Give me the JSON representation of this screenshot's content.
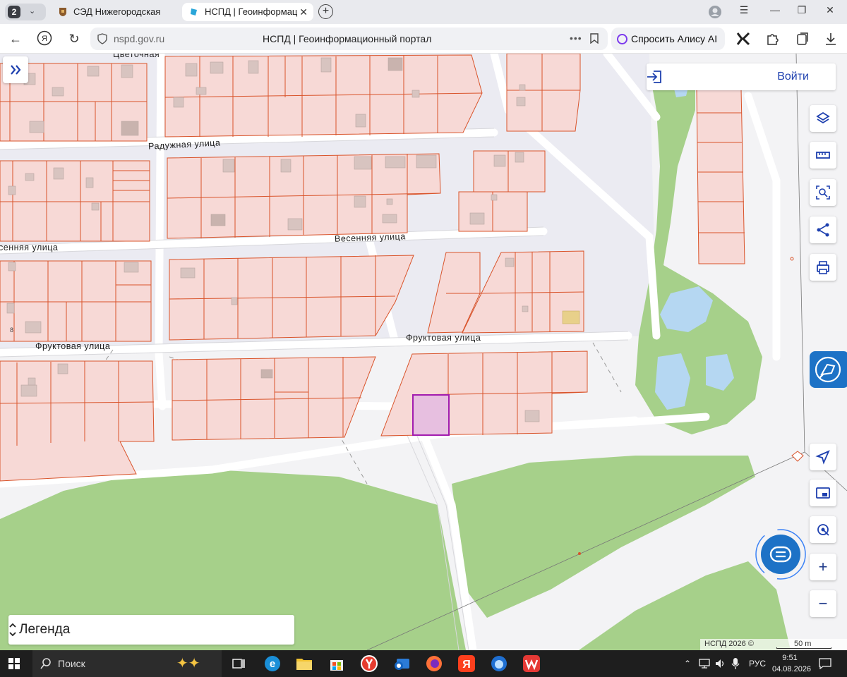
{
  "browser": {
    "tab_count": "2",
    "tabs": [
      {
        "title": "СЭД Нижегородская обл",
        "active": false
      },
      {
        "title": "НСПД | Геоинформаци",
        "active": true
      }
    ],
    "url": "nspd.gov.ru",
    "page_title": "НСПД | Геоинформационный портал",
    "alice_label": "Спросить Алису AI"
  },
  "map": {
    "login_label": "Войти",
    "legend_label": "Легенда",
    "copyright": "НСПД 2026 ©",
    "scale_label": "50 m",
    "streets": [
      {
        "label": "Цветочная"
      },
      {
        "label": "Радужная улица"
      },
      {
        "label": "Весенняя улица"
      },
      {
        "label": "сенняя улица"
      },
      {
        "label": "Фруктовая улица"
      },
      {
        "label": "Фруктовая улица"
      }
    ],
    "parcel_number": "8",
    "controls": [
      "layers-icon",
      "ruler-icon",
      "search-area-icon",
      "share-icon",
      "print-icon",
      "locate-icon",
      "minimap-icon",
      "geolocation-icon",
      "zoom-in-icon",
      "zoom-out-icon"
    ],
    "colors": {
      "parcel_fill": "#f7d9d6",
      "parcel_border": "#d9542b",
      "selected_border": "#a21caf",
      "green_area": "#a6d08a",
      "water": "#b5d7f2",
      "accent": "#1e40af"
    }
  },
  "taskbar": {
    "search_label": "Поиск",
    "language": "РУС",
    "time": "9:51",
    "date": "04.08.2026"
  }
}
